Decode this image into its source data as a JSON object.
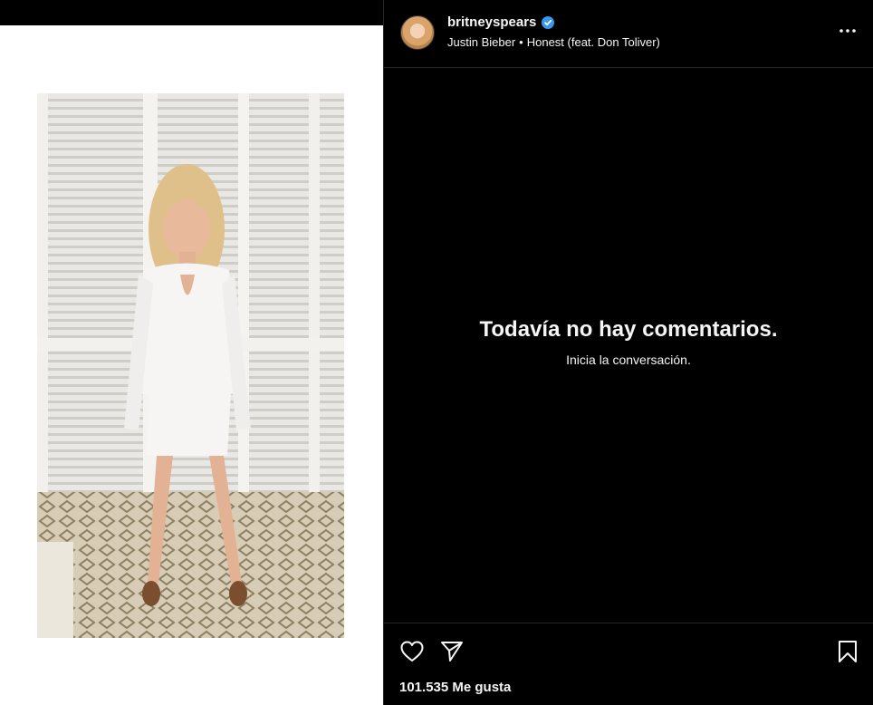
{
  "post": {
    "username": "britneyspears",
    "verified": true,
    "audio": {
      "artist": "Justin Bieber",
      "separator": "•",
      "track": "Honest (feat. Don Toliver)"
    }
  },
  "comments": {
    "empty_title": "Todavía no hay comentarios.",
    "empty_subtitle": "Inicia la conversación."
  },
  "likes_text": "101.535 Me gusta",
  "colors": {
    "background": "#000000",
    "text": "#f5f5f5",
    "divider": "#262626",
    "verified_badge": "#3897f0",
    "media_pane": "#ffffff"
  },
  "icons": {
    "verified": "verified-badge-icon",
    "more": "more-options-icon",
    "like": "heart-icon",
    "share": "paper-plane-icon",
    "save": "bookmark-icon"
  }
}
